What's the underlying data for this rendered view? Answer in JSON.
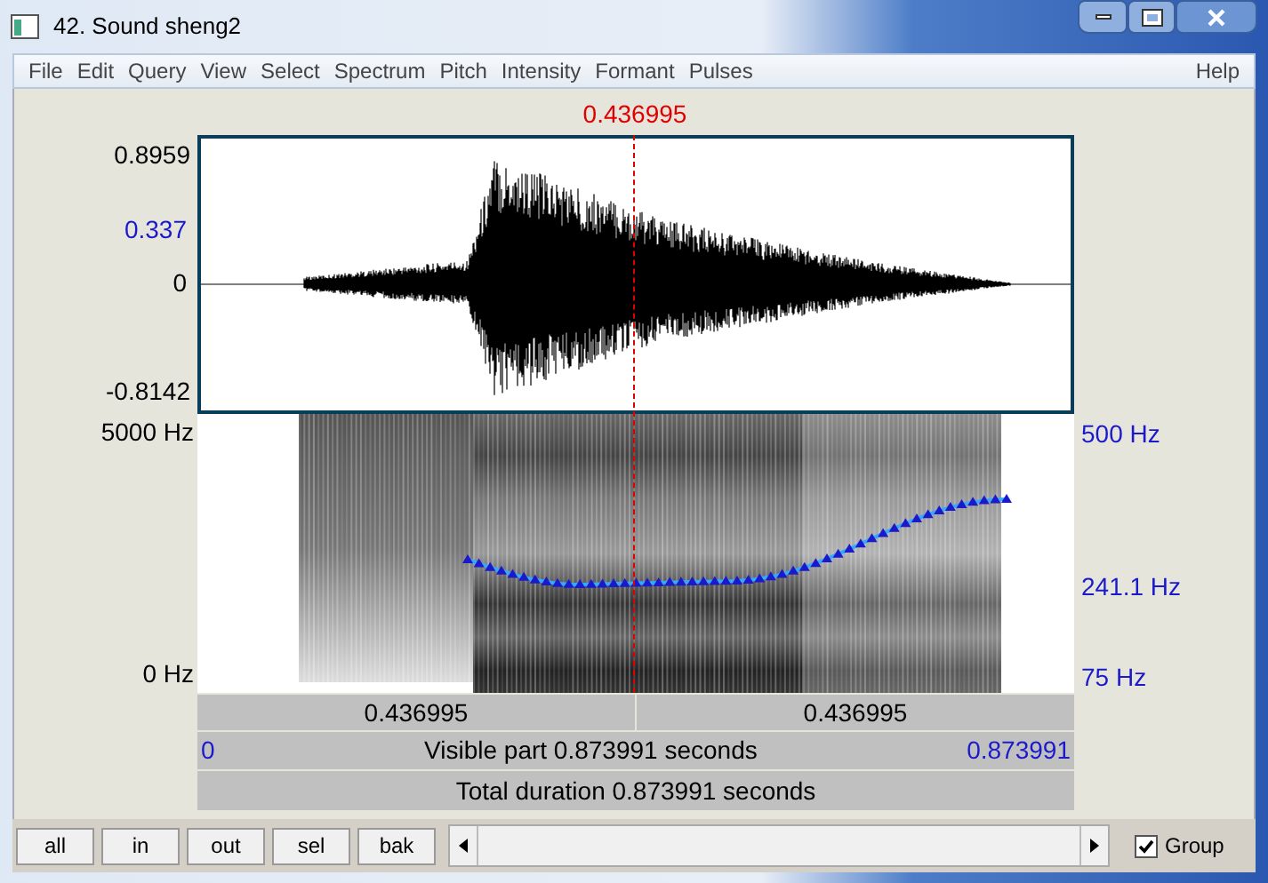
{
  "window": {
    "title": "42. Sound sheng2"
  },
  "menu": {
    "items": [
      "File",
      "Edit",
      "Query",
      "View",
      "Select",
      "Spectrum",
      "Pitch",
      "Intensity",
      "Formant",
      "Pulses"
    ],
    "help": "Help"
  },
  "cursor_time": "0.436995",
  "waveform": {
    "max_label": "0.8959",
    "cursor_value": "0.337",
    "zero_label": "0",
    "min_label": "-0.8142"
  },
  "spectrogram": {
    "top_label": "5000 Hz",
    "bottom_label": "0 Hz",
    "pitch_top": "500 Hz",
    "pitch_cursor": "241.1 Hz",
    "pitch_bottom": "75 Hz"
  },
  "selection_bar": [
    "0.436995",
    "0.436995"
  ],
  "visible_bar": {
    "start": "0",
    "text": "Visible part 0.873991 seconds",
    "end": "0.873991"
  },
  "total_bar": {
    "text": "Total duration 0.873991 seconds"
  },
  "buttons": [
    "all",
    "in",
    "out",
    "sel",
    "bak"
  ],
  "group": {
    "label": "Group",
    "checked": true
  }
}
